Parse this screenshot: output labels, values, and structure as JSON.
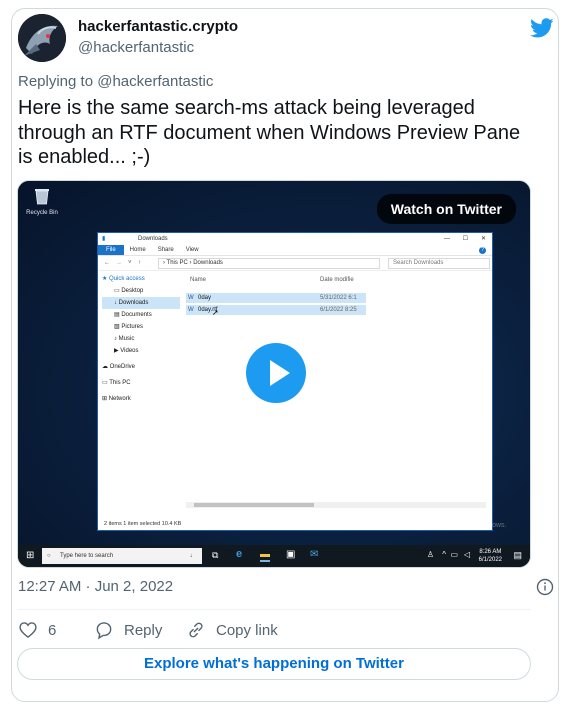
{
  "author": {
    "display_name": "hackerfantastic.crypto",
    "handle": "@hackerfantastic"
  },
  "replying": {
    "prefix": "Replying to",
    "target": "@hackerfantastic"
  },
  "tweet": {
    "text": "Here is the same search-ms attack being leveraged through an RTF document when Windows Preview Pane is enabled... ;-)",
    "time": "12:27 AM · Jun 2, 2022",
    "likes": "6",
    "reply_label": "Reply",
    "copy_label": "Copy link",
    "explore_label": "Explore what's happening on Twitter"
  },
  "media": {
    "watch_label": "Watch on Twitter",
    "desktop": {
      "recycle_label": "Recycle Bin",
      "activate_title": "Activate Windows",
      "activate_sub": "Go to Settings to activate Windows."
    },
    "explorer": {
      "title": "Downloads",
      "tabs": [
        "File",
        "Home",
        "Share",
        "View"
      ],
      "address": "› This PC › Downloads",
      "search_placeholder": "Search Downloads",
      "nav_items": [
        "Quick access",
        "Desktop",
        "Downloads",
        "Documents",
        "Pictures",
        "Music",
        "Videos",
        "OneDrive",
        "This PC",
        "Network"
      ],
      "col_name": "Name",
      "col_date": "Date modifie",
      "files": [
        {
          "name": "0day",
          "date": "5/31/2022 6:1"
        },
        {
          "name": "0day.rtf",
          "date": "6/1/2022 8:25"
        }
      ],
      "status": "2 items    1 item selected  10.4 KB"
    },
    "taskbar": {
      "search_placeholder": "Type here to search",
      "clock_time": "8:26 AM",
      "clock_date": "6/1/2022"
    }
  },
  "colors": {
    "twitter_blue": "#1d9bf0",
    "link_blue": "#006fd6",
    "secondary_text": "#536471",
    "border": "#cfd9de"
  }
}
